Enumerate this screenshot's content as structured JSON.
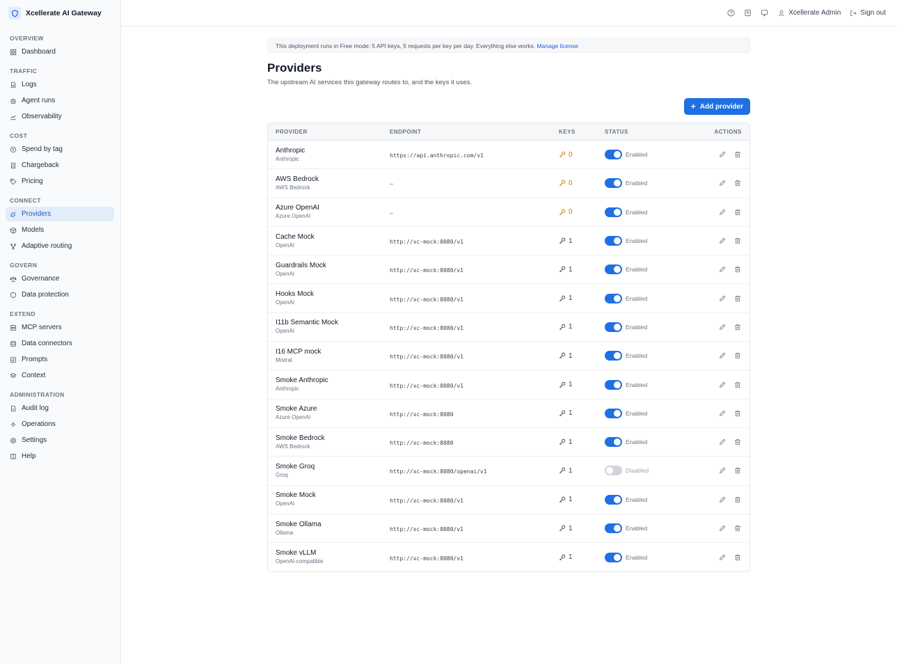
{
  "brand": {
    "name": "Xcellerate AI Gateway",
    "icon": "shield-logo-icon",
    "color": "#1f6fe5"
  },
  "sidebar": {
    "sections": [
      {
        "heading": "OVERVIEW",
        "items": [
          {
            "label": "Dashboard",
            "icon": "dashboard-icon"
          }
        ]
      },
      {
        "heading": "TRAFFIC",
        "items": [
          {
            "label": "Logs",
            "icon": "document-icon"
          },
          {
            "label": "Agent runs",
            "icon": "robot-icon"
          },
          {
            "label": "Observability",
            "icon": "chart-icon"
          }
        ]
      },
      {
        "heading": "COST",
        "items": [
          {
            "label": "Spend by tag",
            "icon": "coin-icon"
          },
          {
            "label": "Chargeback",
            "icon": "receipt-icon"
          },
          {
            "label": "Pricing",
            "icon": "tag-icon"
          }
        ]
      },
      {
        "heading": "CONNECT",
        "items": [
          {
            "label": "Providers",
            "icon": "plug-icon",
            "active": true
          },
          {
            "label": "Models",
            "icon": "cube-icon"
          },
          {
            "label": "Adaptive routing",
            "icon": "route-icon"
          }
        ]
      },
      {
        "heading": "GOVERN",
        "items": [
          {
            "label": "Governance",
            "icon": "scale-icon"
          },
          {
            "label": "Data protection",
            "icon": "shield-icon"
          }
        ]
      },
      {
        "heading": "EXTEND",
        "items": [
          {
            "label": "MCP servers",
            "icon": "server-icon"
          },
          {
            "label": "Data connectors",
            "icon": "database-icon"
          },
          {
            "label": "Prompts",
            "icon": "prompt-icon"
          },
          {
            "label": "Context",
            "icon": "layers-icon"
          }
        ]
      },
      {
        "heading": "ADMINISTRATION",
        "items": [
          {
            "label": "Audit log",
            "icon": "audit-icon"
          },
          {
            "label": "Operations",
            "icon": "operations-icon"
          },
          {
            "label": "Settings",
            "icon": "gear-icon"
          },
          {
            "label": "Help",
            "icon": "book-icon"
          }
        ]
      }
    ]
  },
  "topbar": {
    "user": "Xcellerate Admin",
    "signout": "Sign out"
  },
  "banner": {
    "text": "This deployment runs in Free mode: 5 API keys, 5 requests per key per day. Everything else works.",
    "link": "Manage license"
  },
  "page": {
    "title": "Providers",
    "subtitle": "The upstream AI services this gateway routes to, and the keys it uses.",
    "add_label": "Add provider"
  },
  "table": {
    "headers": {
      "provider": "PROVIDER",
      "endpoint": "ENDPOINT",
      "keys": "KEYS",
      "status": "STATUS",
      "actions": "ACTIONS"
    },
    "rows": [
      {
        "name": "Anthropic",
        "type": "Anthropic",
        "endpoint": "https://api.anthropic.com/v1",
        "keys": "0",
        "status": "Enabled",
        "enabled": true
      },
      {
        "name": "AWS Bedrock",
        "type": "AWS Bedrock",
        "endpoint": "–",
        "keys": "0",
        "status": "Enabled",
        "enabled": true
      },
      {
        "name": "Azure OpenAI",
        "type": "Azure OpenAI",
        "endpoint": "–",
        "keys": "0",
        "status": "Enabled",
        "enabled": true
      },
      {
        "name": "Cache Mock",
        "type": "OpenAI",
        "endpoint": "http://xc-mock:8080/v1",
        "keys": "1",
        "status": "Enabled",
        "enabled": true
      },
      {
        "name": "Guardrails Mock",
        "type": "OpenAI",
        "endpoint": "http://xc-mock:8080/v1",
        "keys": "1",
        "status": "Enabled",
        "enabled": true
      },
      {
        "name": "Hooks Mock",
        "type": "OpenAI",
        "endpoint": "http://xc-mock:8080/v1",
        "keys": "1",
        "status": "Enabled",
        "enabled": true
      },
      {
        "name": "I11b Semantic Mock",
        "type": "OpenAI",
        "endpoint": "http://xc-mock:8080/v1",
        "keys": "1",
        "status": "Enabled",
        "enabled": true
      },
      {
        "name": "I16 MCP mock",
        "type": "Mistral",
        "endpoint": "http://xc-mock:8080/v1",
        "keys": "1",
        "status": "Enabled",
        "enabled": true
      },
      {
        "name": "Smoke Anthropic",
        "type": "Anthropic",
        "endpoint": "http://xc-mock:8080/v1",
        "keys": "1",
        "status": "Enabled",
        "enabled": true
      },
      {
        "name": "Smoke Azure",
        "type": "Azure OpenAI",
        "endpoint": "http://xc-mock:8080",
        "keys": "1",
        "status": "Enabled",
        "enabled": true
      },
      {
        "name": "Smoke Bedrock",
        "type": "AWS Bedrock",
        "endpoint": "http://xc-mock:8080",
        "keys": "1",
        "status": "Enabled",
        "enabled": true
      },
      {
        "name": "Smoke Groq",
        "type": "Groq",
        "endpoint": "http://xc-mock:8080/openai/v1",
        "keys": "1",
        "status": "Disabled",
        "enabled": false
      },
      {
        "name": "Smoke Mock",
        "type": "OpenAI",
        "endpoint": "http://xc-mock:8080/v1",
        "keys": "1",
        "status": "Enabled",
        "enabled": true
      },
      {
        "name": "Smoke Ollama",
        "type": "Ollama",
        "endpoint": "http://xc-mock:8080/v1",
        "keys": "1",
        "status": "Enabled",
        "enabled": true
      },
      {
        "name": "Smoke vLLM",
        "type": "OpenAI-compatible",
        "endpoint": "http://xc-mock:8080/v1",
        "keys": "1",
        "status": "Enabled",
        "enabled": true
      }
    ]
  },
  "colors": {
    "accent": "#1f6fe5",
    "key_warning": "#c77a0a",
    "active_nav_bg": "#e3ecf9"
  }
}
